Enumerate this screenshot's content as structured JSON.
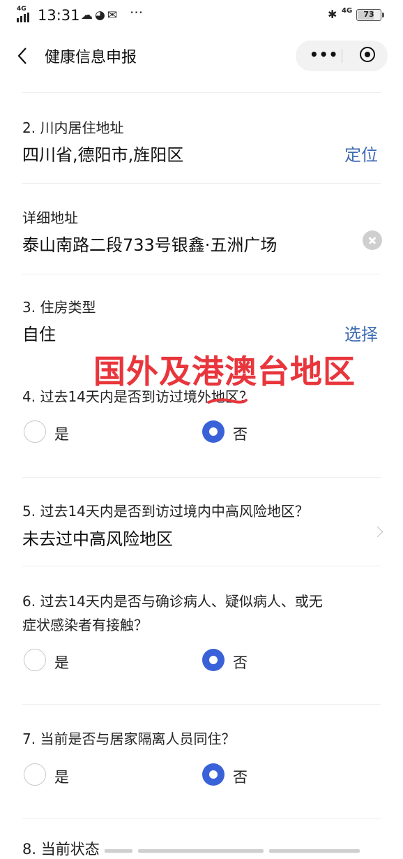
{
  "status_bar": {
    "network": "4G",
    "time": "13:31",
    "more": "···",
    "network_right": "4G",
    "battery": "73",
    "battery_level": 0.73
  },
  "nav": {
    "title": "健康信息申报",
    "more": "•••"
  },
  "q2": {
    "label": "2. 川内居住地址",
    "value": "四川省,德阳市,旌阳区",
    "action": "定位"
  },
  "detail": {
    "label": "详细地址",
    "value": "泰山南路二段733号银鑫·五洲广场"
  },
  "q3": {
    "label": "3. 住房类型",
    "value": "自住",
    "action": "选择"
  },
  "annotation": {
    "text": "国外及港澳台地区",
    "color": "#e8363c"
  },
  "q4": {
    "label": "4. 过去14天内是否到访过境外地区？",
    "options": [
      "是",
      "否"
    ],
    "selected": "否"
  },
  "q5": {
    "label": "5. 过去14天内是否到访过境内中高风险地区？",
    "value": "未去过中高风险地区"
  },
  "q6": {
    "label_line1": "6. 过去14天内是否与确诊病人、疑似病人、或无",
    "label_line2": "症状感染者有接触？",
    "options": [
      "是",
      "否"
    ],
    "selected": "否"
  },
  "q7": {
    "label": "7. 当前是否与居家隔离人员同住？",
    "options": [
      "是",
      "否"
    ],
    "selected": "否"
  },
  "q8": {
    "label": "8. 当前状态"
  },
  "colors": {
    "accent_link": "#3d6bb2",
    "radio_selected": "#3a62d8"
  }
}
